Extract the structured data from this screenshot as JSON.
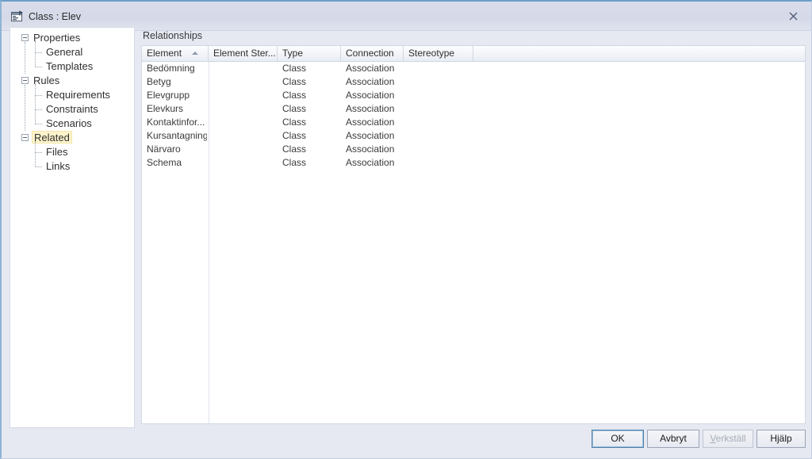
{
  "window": {
    "title": "Class : Elev",
    "icon": "class-dialog-icon",
    "close_label": "✕"
  },
  "sidebar": {
    "items": [
      {
        "label": "Properties",
        "level": 0,
        "expandable": true,
        "selected": false
      },
      {
        "label": "General",
        "level": 1,
        "expandable": false,
        "selected": false
      },
      {
        "label": "Templates",
        "level": 1,
        "expandable": false,
        "selected": false
      },
      {
        "label": "Rules",
        "level": 0,
        "expandable": true,
        "selected": false
      },
      {
        "label": "Requirements",
        "level": 1,
        "expandable": false,
        "selected": false
      },
      {
        "label": "Constraints",
        "level": 1,
        "expandable": false,
        "selected": false
      },
      {
        "label": "Scenarios",
        "level": 1,
        "expandable": false,
        "selected": false
      },
      {
        "label": "Related",
        "level": 0,
        "expandable": true,
        "selected": true
      },
      {
        "label": "Files",
        "level": 1,
        "expandable": false,
        "selected": false
      },
      {
        "label": "Links",
        "level": 1,
        "expandable": false,
        "selected": false
      }
    ]
  },
  "main": {
    "section_label": "Relationships",
    "table": {
      "columns": [
        {
          "label": "Element",
          "sorted": "asc"
        },
        {
          "label": "Element Ster..."
        },
        {
          "label": "Type"
        },
        {
          "label": "Connection"
        },
        {
          "label": "Stereotype"
        }
      ],
      "rows": [
        {
          "element": "Bedömning",
          "element_stereotype": "",
          "type": "Class",
          "connection": "Association",
          "stereotype": ""
        },
        {
          "element": "Betyg",
          "element_stereotype": "",
          "type": "Class",
          "connection": "Association",
          "stereotype": ""
        },
        {
          "element": "Elevgrupp",
          "element_stereotype": "",
          "type": "Class",
          "connection": "Association",
          "stereotype": ""
        },
        {
          "element": "Elevkurs",
          "element_stereotype": "",
          "type": "Class",
          "connection": "Association",
          "stereotype": ""
        },
        {
          "element": "Kontaktinfor...",
          "element_stereotype": "",
          "type": "Class",
          "connection": "Association",
          "stereotype": ""
        },
        {
          "element": "Kursantagning",
          "element_stereotype": "",
          "type": "Class",
          "connection": "Association",
          "stereotype": ""
        },
        {
          "element": "Närvaro",
          "element_stereotype": "",
          "type": "Class",
          "connection": "Association",
          "stereotype": ""
        },
        {
          "element": "Schema",
          "element_stereotype": "",
          "type": "Class",
          "connection": "Association",
          "stereotype": ""
        }
      ]
    }
  },
  "footer": {
    "ok": "OK",
    "cancel": "Avbryt",
    "apply": "Verkställ",
    "apply_mnemonic": "V",
    "apply_rest": "erkställ",
    "help": "Hjälp"
  },
  "colors": {
    "titlebar": "#d6dae8",
    "dialog_bg": "#e6e9f2",
    "selection_highlight": "#fdf4cd",
    "accent_border": "#6b9ec9"
  }
}
